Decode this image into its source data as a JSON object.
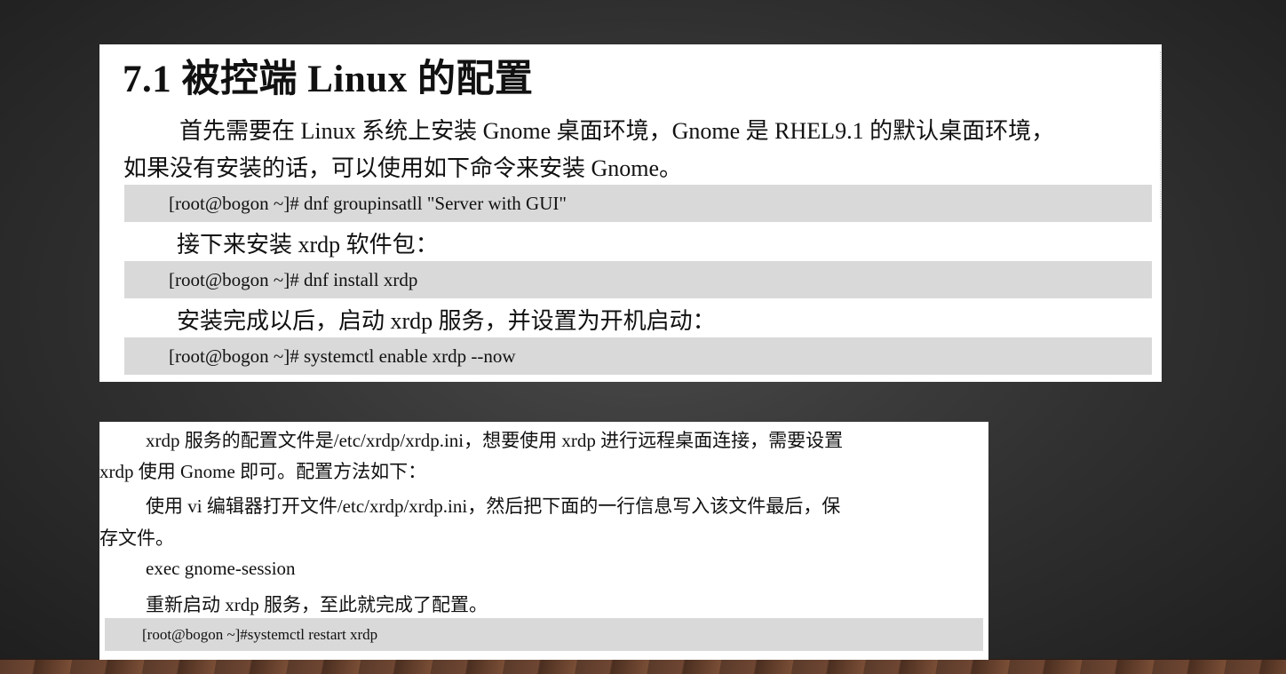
{
  "panel1": {
    "title": "7.1 被控端 Linux 的配置",
    "para1_line1": "首先需要在 Linux 系统上安装 Gnome 桌面环境，Gnome 是 RHEL9.1 的默认桌面环境，",
    "para1_line2": "如果没有安装的话，可以使用如下命令来安装 Gnome。",
    "cmd1": "[root@bogon ~]# dnf groupinsatll \"Server with GUI\"",
    "para2": "接下来安装 xrdp 软件包：",
    "cmd2": "[root@bogon ~]# dnf install xrdp",
    "para3": "安装完成以后，启动 xrdp 服务，并设置为开机启动：",
    "cmd3": "[root@bogon ~]# systemctl enable xrdp --now"
  },
  "panel2": {
    "line1": "xrdp 服务的配置文件是/etc/xrdp/xrdp.ini，想要使用 xrdp 进行远程桌面连接，需要设置",
    "line2": "xrdp 使用 Gnome 即可。配置方法如下：",
    "line3": "使用 vi 编辑器打开文件/etc/xrdp/xrdp.ini，然后把下面的一行信息写入该文件最后，保",
    "line4": "存文件。",
    "line5": "exec gnome-session",
    "line6": "重新启动 xrdp 服务，至此就完成了配置。",
    "cmd": "[root@bogon ~]#systemctl restart xrdp"
  }
}
